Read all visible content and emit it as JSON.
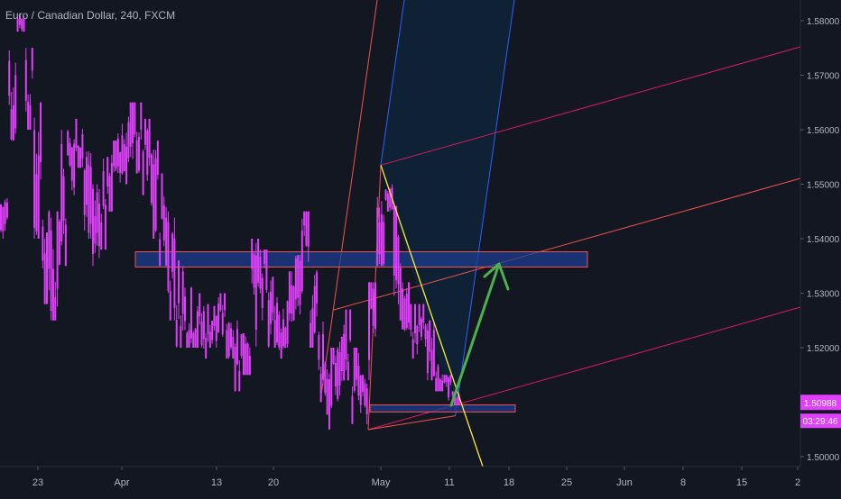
{
  "header": {
    "symbol_title": "Euro / Canadian Dollar, 240, FXCM"
  },
  "chart_data": {
    "type": "candlestick",
    "symbol": "Euro / Canadian Dollar",
    "timeframe": "240",
    "source": "FXCM",
    "x_ticks": [
      "23",
      "Apr",
      "13",
      "20",
      "May",
      "11",
      "18",
      "25",
      "Jun",
      "8",
      "15",
      "2"
    ],
    "y_ticks": [
      "1.58000",
      "1.57000",
      "1.56000",
      "1.55000",
      "1.54000",
      "1.53000",
      "1.52000",
      "1.50000"
    ],
    "ylim": [
      1.499,
      1.582
    ],
    "last_price": "1.50988",
    "countdown": "03:29:46",
    "price_path": [
      [
        1.54,
        1.548
      ],
      [
        1.558,
        1.575
      ],
      [
        1.578,
        1.582
      ],
      [
        1.56,
        1.575
      ],
      [
        1.54,
        1.565
      ],
      [
        1.528,
        1.548
      ],
      [
        1.525,
        1.545
      ],
      [
        1.535,
        1.56
      ],
      [
        1.548,
        1.56
      ],
      [
        1.553,
        1.562
      ],
      [
        1.54,
        1.556
      ],
      [
        1.535,
        1.55
      ],
      [
        1.538,
        1.555
      ],
      [
        1.545,
        1.558
      ],
      [
        1.55,
        1.562
      ],
      [
        1.55,
        1.565
      ],
      [
        1.552,
        1.565
      ],
      [
        1.548,
        1.562
      ],
      [
        1.54,
        1.558
      ],
      [
        1.535,
        1.552
      ],
      [
        1.525,
        1.545
      ],
      [
        1.52,
        1.536
      ],
      [
        1.52,
        1.532
      ],
      [
        1.52,
        1.53
      ],
      [
        1.518,
        1.528
      ],
      [
        1.52,
        1.528
      ],
      [
        1.522,
        1.53
      ],
      [
        1.518,
        1.528
      ],
      [
        1.512,
        1.525
      ],
      [
        1.515,
        1.526
      ],
      [
        1.52,
        1.54
      ],
      [
        1.525,
        1.538
      ],
      [
        1.52,
        1.533
      ],
      [
        1.518,
        1.532
      ],
      [
        1.52,
        1.534
      ],
      [
        1.525,
        1.537
      ],
      [
        1.53,
        1.545
      ],
      [
        1.52,
        1.535
      ],
      [
        1.51,
        1.525
      ],
      [
        1.505,
        1.52
      ],
      [
        1.51,
        1.522
      ],
      [
        1.514,
        1.527
      ],
      [
        1.506,
        1.52
      ],
      [
        1.5055,
        1.515
      ],
      [
        1.51,
        1.532
      ],
      [
        1.535,
        1.553
      ],
      [
        1.545,
        1.55
      ],
      [
        1.525,
        1.546
      ],
      [
        1.522,
        1.532
      ],
      [
        1.518,
        1.528
      ],
      [
        1.52,
        1.528
      ],
      [
        1.514,
        1.525
      ],
      [
        1.512,
        1.52
      ],
      [
        1.51,
        1.515
      ],
      [
        1.5095,
        1.512
      ]
    ],
    "zones": [
      {
        "price_top": 1.5376,
        "price_bottom": 1.5348,
        "color": "#1e3c8c"
      },
      {
        "price_top": 1.5095,
        "price_bottom": 1.5082,
        "color": "#1e3c8c"
      }
    ],
    "pitchfork": {
      "pivot_a": {
        "x_ticks": 4.0,
        "price": 1.5535
      },
      "pivot_b": {
        "x_ticks": 2.3,
        "price": 1.5055
      },
      "pivot_c": {
        "x_ticks": 5.1,
        "price": 1.5075
      }
    },
    "trendline": {
      "from": {
        "x_ticks": 4.0,
        "price": 1.5535
      },
      "to": {
        "x_ticks": 5.5,
        "price": 1.499
      }
    },
    "arrow": {
      "from": {
        "x_ticks": 5.1,
        "price": 1.5078
      },
      "to": {
        "x_ticks": 5.6,
        "price": 1.5355
      }
    },
    "colors": {
      "background": "#131722",
      "candle": "#e040fb",
      "zone_border": "#ef5350",
      "pitchfork_outer": "#2962ff",
      "pitchfork_fill": "#0d2a45",
      "median": "#ef5350",
      "inner_lines": "#d81b60",
      "trendline": "#ffeb3b",
      "arrow": "#4caf50",
      "price_tag": "#e040fb"
    }
  }
}
